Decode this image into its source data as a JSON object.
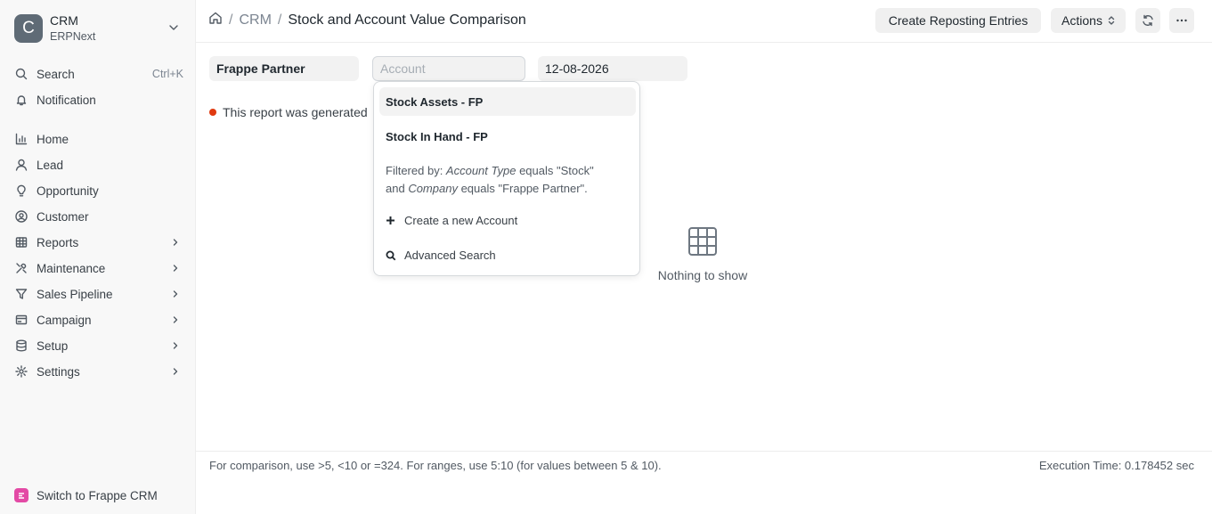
{
  "sidebar": {
    "brand": {
      "logo_letter": "C",
      "title": "CRM",
      "subtitle": "ERPNext"
    },
    "search": {
      "label": "Search",
      "shortcut": "Ctrl+K"
    },
    "notification": {
      "label": "Notification"
    },
    "items": [
      {
        "label": "Home",
        "icon": "home-chart-icon"
      },
      {
        "label": "Lead",
        "icon": "user-icon"
      },
      {
        "label": "Opportunity",
        "icon": "lightbulb-icon"
      },
      {
        "label": "Customer",
        "icon": "user-circle-icon"
      },
      {
        "label": "Reports",
        "icon": "table-icon",
        "expandable": true
      },
      {
        "label": "Maintenance",
        "icon": "tools-icon",
        "expandable": true
      },
      {
        "label": "Sales Pipeline",
        "icon": "funnel-icon",
        "expandable": true
      },
      {
        "label": "Campaign",
        "icon": "card-icon",
        "expandable": true
      },
      {
        "label": "Setup",
        "icon": "database-icon",
        "expandable": true
      },
      {
        "label": "Settings",
        "icon": "gear-icon",
        "expandable": true
      }
    ],
    "switch_label": "Switch to Frappe CRM"
  },
  "header": {
    "breadcrumb": [
      "CRM"
    ],
    "title": "Stock and Account Value Comparison",
    "create_reposting_label": "Create Reposting Entries",
    "actions_label": "Actions"
  },
  "filters": {
    "company": "Frappe Partner",
    "account_placeholder": "Account",
    "date": "12-08-2026"
  },
  "notice": "This report was generated",
  "empty_state": "Nothing to show",
  "dropdown": {
    "options": [
      "Stock Assets - FP",
      "Stock In Hand - FP"
    ],
    "filter_prefix": "Filtered by: ",
    "filter_field1": "Account Type",
    "filter_text1": " equals \"Stock\"",
    "filter_and": "and ",
    "filter_field2": "Company",
    "filter_text2": " equals \"Frappe Partner\".",
    "create_new": "Create a new Account",
    "advanced_search": "Advanced Search"
  },
  "footer": {
    "hint": "For comparison, use >5, <10 or =324. For ranges, use 5:10 (for values between 5 & 10).",
    "execution_time": "Execution Time: 0.178452 sec"
  },
  "colors": {
    "notice_dot": "#e03a10",
    "switch_badge": "#e34aa5"
  }
}
